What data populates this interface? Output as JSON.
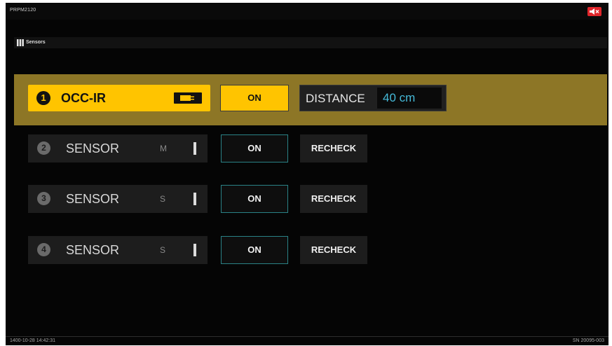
{
  "header": {
    "model": "PRPM2120",
    "mute_icon": "speaker-muted-icon"
  },
  "section": {
    "icon": "grid-icon",
    "title": "Sensors"
  },
  "active_sensor": {
    "number": "1",
    "label": "OCC-IR",
    "icon": "plug-icon",
    "on_label": "ON",
    "distance_label": "DISTANCE",
    "distance_value": "40 cm"
  },
  "sensors": [
    {
      "number": "2",
      "label": "SENSOR",
      "mode": "M",
      "on_label": "ON",
      "recheck_label": "RECHECK"
    },
    {
      "number": "3",
      "label": "SENSOR",
      "mode": "S",
      "on_label": "ON",
      "recheck_label": "RECHECK"
    },
    {
      "number": "4",
      "label": "SENSOR",
      "mode": "S",
      "on_label": "ON",
      "recheck_label": "RECHECK"
    }
  ],
  "footer": {
    "datetime": "1400-10-28 14:42:31",
    "serial": "SN 20095-003"
  },
  "colors": {
    "accent": "#ffc400",
    "active_row": "#8d7626",
    "mute": "#e0262b",
    "distance_value": "#45b9d8",
    "on_border": "#2a8286"
  }
}
